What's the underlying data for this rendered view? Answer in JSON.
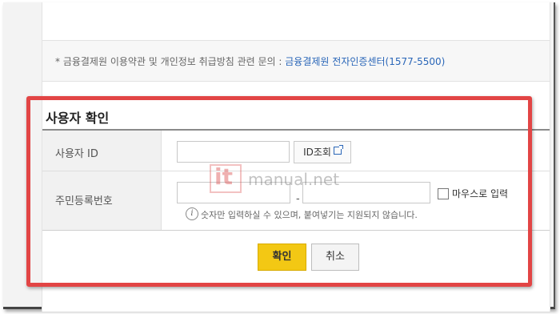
{
  "notice": {
    "prefix": "* 금융결제원 이용약관 및 개인정보 취급방침 관련 문의 : ",
    "link": "금융결제원 전자인증센터(1577-5500)"
  },
  "section": {
    "title": "사용자 확인"
  },
  "form": {
    "user_id_label": "사용자 ID",
    "user_id_value": "",
    "id_lookup_label": "ID조회",
    "rrn_label": "주민등록번호",
    "rrn_separator": "-",
    "rrn_front_value": "",
    "rrn_back_value": "",
    "mouse_input_label": "마우스로 입력",
    "info_icon_glyph": "i",
    "helper_text": "숫자만 입력하실 수 있으며, 붙여넣기는 지원되지 않습니다."
  },
  "buttons": {
    "confirm": "확인",
    "cancel": "취소"
  },
  "watermark": {
    "logo": "it",
    "text": "manual.net"
  },
  "colors": {
    "highlight": "#e24545",
    "confirm_button": "#f3c814",
    "link": "#2a66b8"
  },
  "icons": [
    "external-link-icon",
    "info-icon",
    "checkbox-icon"
  ]
}
